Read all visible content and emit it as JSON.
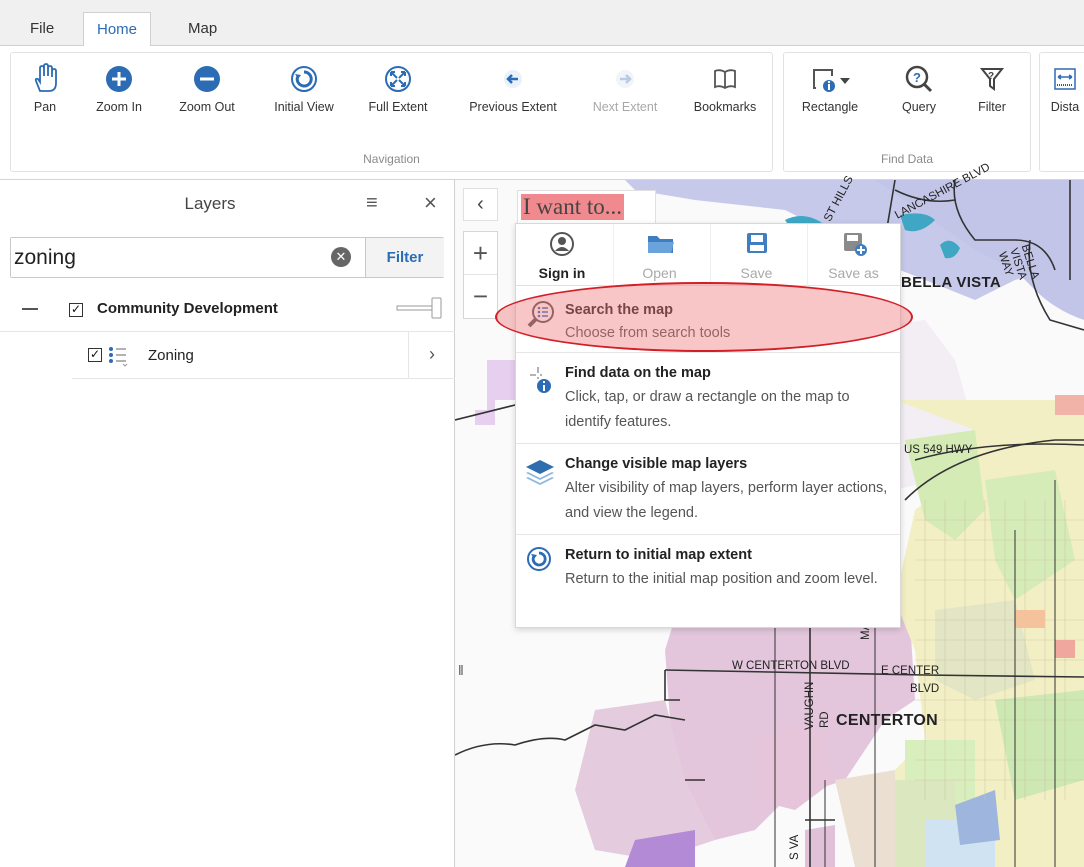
{
  "ribbon": {
    "tabs": [
      {
        "label": "File",
        "active": false
      },
      {
        "label": "Home",
        "active": true
      },
      {
        "label": "Map",
        "active": false
      }
    ],
    "navigation": {
      "group_label": "Navigation",
      "tools": [
        {
          "label": "Pan",
          "icon": "hand-icon"
        },
        {
          "label": "Zoom In",
          "icon": "plus-circle-icon"
        },
        {
          "label": "Zoom Out",
          "icon": "minus-circle-icon"
        },
        {
          "label": "Initial View",
          "icon": "reset-icon"
        },
        {
          "label": "Full Extent",
          "icon": "expand-icon"
        },
        {
          "label": "Previous Extent",
          "icon": "arrow-left-icon"
        },
        {
          "label": "Next Extent",
          "icon": "arrow-right-icon",
          "disabled": true
        },
        {
          "label": "Bookmarks",
          "icon": "book-icon"
        }
      ]
    },
    "find_data": {
      "group_label": "Find Data",
      "tools": [
        {
          "label": "Rectangle",
          "icon": "rectangle-select-icon"
        },
        {
          "label": "Query",
          "icon": "query-icon"
        },
        {
          "label": "Filter",
          "icon": "funnel-icon"
        }
      ]
    },
    "measure": {
      "tools": [
        {
          "label": "Dista",
          "icon": "ruler-icon"
        }
      ]
    }
  },
  "layers_panel": {
    "title": "Layers",
    "search": {
      "value": "zoning",
      "placeholder": ""
    },
    "filter_label": "Filter",
    "groups": [
      {
        "label": "Community Development",
        "checked": true,
        "layers": [
          {
            "label": "Zoning",
            "checked": true
          }
        ]
      }
    ]
  },
  "iwant": {
    "label": "I want to...",
    "tools": [
      {
        "label": "Sign in",
        "icon": "user-icon",
        "disabled": false
      },
      {
        "label": "Open",
        "icon": "folder-icon",
        "disabled": true
      },
      {
        "label": "Save",
        "icon": "save-icon",
        "disabled": true
      },
      {
        "label": "Save as",
        "icon": "save-as-icon",
        "disabled": true
      }
    ],
    "items": [
      {
        "title": "Search the map",
        "desc": "Choose from search tools",
        "icon": "search-list-icon"
      },
      {
        "title": "Find data on the map",
        "desc": "Click, tap, or draw a rectangle on the map to identify features.",
        "icon": "identify-icon"
      },
      {
        "title": "Change visible map layers",
        "desc": "Alter visibility of map layers, perform layer actions, and view the legend.",
        "icon": "layers-icon"
      },
      {
        "title": "Return to initial map extent",
        "desc": "Return to the initial map position and zoom level.",
        "icon": "reset-icon"
      }
    ]
  },
  "map": {
    "labels": {
      "bella_vista": "BELLA VISTA",
      "centerton": "CENTERTON",
      "us549": "US 549 HWY",
      "centerton_blvd": "W CENTERTON BLVD",
      "e_center": "E CENTER",
      "blvd": "BLVD",
      "lancashire": "LANCASHIRE BLVD",
      "st_hills": "ST HILLS",
      "bella_vista_way": "BELLA VISTA WAY",
      "vaughn": "VAUGHN",
      "rd": "RD",
      "ma": "MA",
      "s_va": "S VA"
    }
  }
}
